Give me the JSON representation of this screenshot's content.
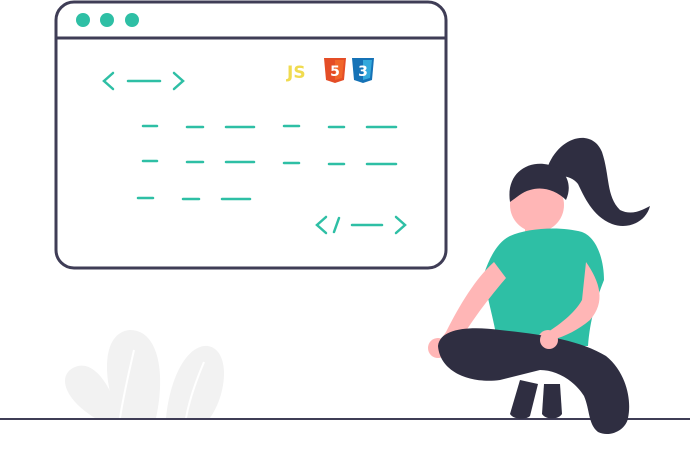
{
  "badges": {
    "js": "JS",
    "html5": "5",
    "css3": "3"
  },
  "icons": [
    "code-open-tag-icon",
    "code-close-tag-icon",
    "js-logo-icon",
    "html5-logo-icon",
    "css3-logo-icon"
  ],
  "colors": {
    "accent": "#2ebfa5",
    "outline": "#3f3d56",
    "dark": "#2f2e41",
    "skin": "#ffb6b6",
    "plant": "#f2f2f2",
    "js": "#f0db4f",
    "html5": "#e44d26",
    "css3": "#1572b6"
  }
}
